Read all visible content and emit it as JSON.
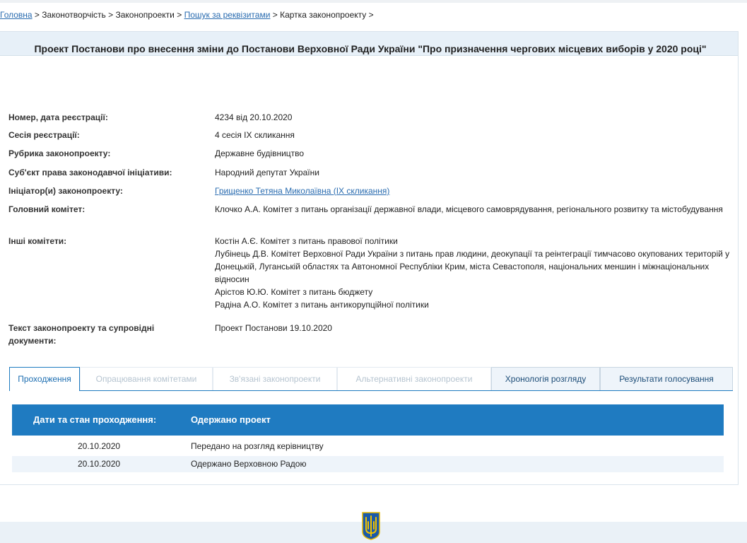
{
  "breadcrumb": {
    "home": "Головна",
    "sep": " > ",
    "lawmaking": "Законотворчість",
    "bills": "Законопроекти",
    "search": "Пошук за реквізитами",
    "card": "Картка законопроекту",
    "tail": " >"
  },
  "bill": {
    "title": "Проект Постанови про внесення зміни до Постанови Верховної Ради України \"Про призначення чергових місцевих виборів у 2020 році\""
  },
  "fields": {
    "reg": {
      "label": "Номер, дата реєстрації:",
      "value": "4234 від 20.10.2020"
    },
    "session": {
      "label": "Сесія реєстрації:",
      "value": "4 сесія IX скликання"
    },
    "rubric": {
      "label": "Рубрика законопроекту:",
      "value": "Державне будівництво"
    },
    "subject": {
      "label": "Суб'єкт права законодавчої ініціативи:",
      "value": "Народний депутат України"
    },
    "initiator": {
      "label": "Ініціатор(и) законопроекту:",
      "value": "Грищенко Тетяна Миколаївна (IX скликання)"
    },
    "main_committee": {
      "label": "Головний комітет:",
      "value": "Клочко А.А. Комітет з питань організації державної влади, місцевого самоврядування, регіонального розвитку та містобудування"
    },
    "other_committees": {
      "label": "Інші комітети:",
      "items": [
        "Костін А.Є. Комітет з питань правової політики",
        "Лубінець Д.В. Комітет Верховної Ради України з питань прав людини, деокупації та реінтеграції тимчасово окупованих територій у Донецькій, Луганській областях та Автономної Республіки Крим, міста Севастополя, національних меншин і міжнаціональних відносин",
        "Арістов Ю.Ю. Комітет з питань бюджету",
        "Радіна А.О. Комітет з питань антикорупційної політики"
      ]
    },
    "docs": {
      "label": "Текст законопроекту та супровідні документи:",
      "value": "Проект Постанови 19.10.2020"
    }
  },
  "tabs": [
    {
      "label": "Проходження",
      "state": "active"
    },
    {
      "label": "Опрацювання комітетами",
      "state": "disabled"
    },
    {
      "label": "Зв'язані законопроекти",
      "state": "disabled"
    },
    {
      "label": "Альтернативні законопроекти",
      "state": "disabled"
    },
    {
      "label": "Хронологія розгляду",
      "state": "normal"
    },
    {
      "label": "Результати голосування",
      "state": "normal"
    }
  ],
  "history": {
    "header_label": "Дати та стан проходження:",
    "header_status": "Одержано проект",
    "rows": [
      {
        "date": "20.10.2020",
        "text": "Передано на розгляд керівництву"
      },
      {
        "date": "20.10.2020",
        "text": "Одержано Верховною Радою"
      }
    ]
  },
  "colors": {
    "accent": "#1f7bc1",
    "link": "#2a6cb0",
    "emblem_blue": "#1b5aa8",
    "emblem_gold": "#f2c300"
  },
  "icons": {
    "emblem": "ukraine-trident-emblem-icon"
  }
}
